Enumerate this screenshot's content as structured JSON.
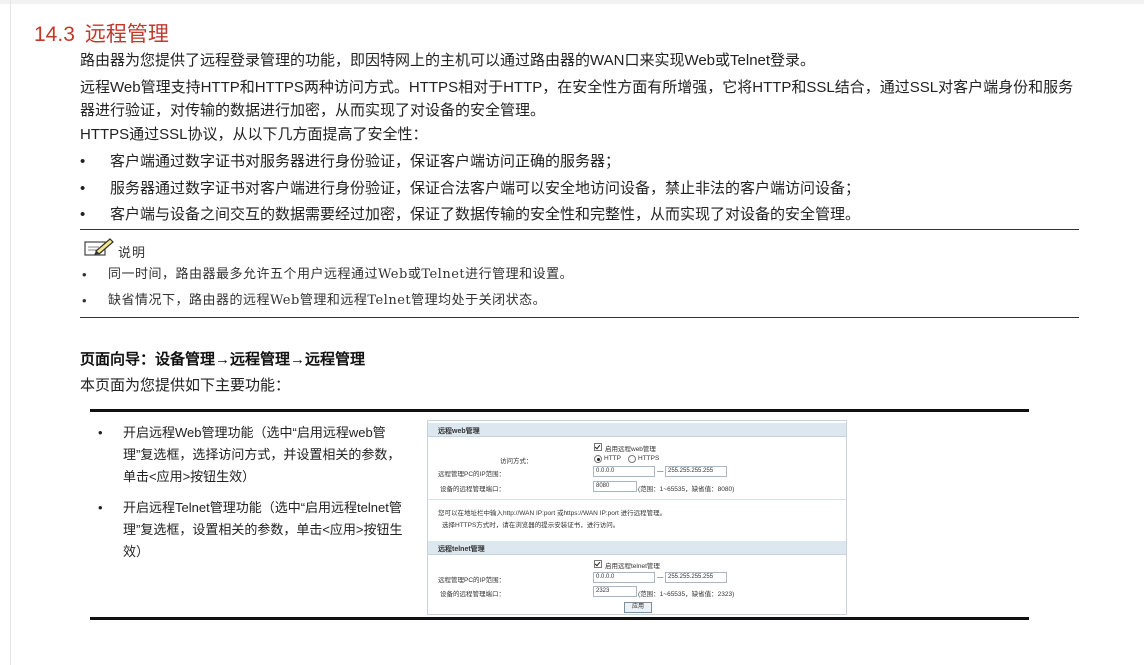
{
  "section": {
    "number": "14.3",
    "title": "远程管理"
  },
  "paragraphs": {
    "p1": "路由器为您提供了远程登录管理的功能，即因特网上的主机可以通过路由器的WAN口来实现Web或Telnet登录。",
    "p2": "远程Web管理支持HTTP和HTTPS两种访问方式。HTTPS相对于HTTP，在安全性方面有所增强，它将HTTP和SSL结合，通过SSL对客户端身份和服务器进行验证，对传输的数据进行加密，从而实现了对设备的安全管理。",
    "p3": "HTTPS通过SSL协议，从以下几方面提高了安全性："
  },
  "bullets": [
    "客户端通过数字证书对服务器进行身份验证，保证客户端访问正确的服务器；",
    "服务器通过数字证书对客户端进行身份验证，保证合法客户端可以安全地访问设备，禁止非法的客户端访问设备；",
    "客户端与设备之间交互的数据需要经过加密，保证了数据传输的安全性和完整性，从而实现了对设备的安全管理。"
  ],
  "note": {
    "label": "说明",
    "items": [
      "同一时间，路由器最多允许五个用户远程通过Web或Telnet进行管理和设置。",
      "缺省情况下，路由器的远程Web管理和远程Telnet管理均处于关闭状态。"
    ]
  },
  "nav_guide": "页面向导：设备管理→远程管理→远程管理",
  "intro": "本页面为您提供如下主要功能：",
  "features": [
    "开启远程Web管理功能（选中“启用远程web管理”复选框，选择访问方式，并设置相关的参数，单击<应用>按钮生效）",
    "开启远程Telnet管理功能（选中“启用远程telnet管理”复选框，设置相关的参数，单击<应用>按钮生效）"
  ],
  "screenshot": {
    "web_title": "远程web管理",
    "web_enable": "启用远程web管理",
    "access_label": "访问方式：",
    "http": "HTTP",
    "https": "HTTPS",
    "ip_range_label": "远程管理PC的IP范围：",
    "ip_from": "0.0.0.0",
    "ip_sep": "—",
    "ip_to": "255.255.255.255",
    "web_port_label": "设备的远程管理端口：",
    "web_port": "8080",
    "web_port_hint": "(范围：1~65535，缺省值：8080)",
    "tip1": "您可以在地址栏中输入http://WAN IP:port 或https://WAN IP:port 进行远程管理。",
    "tip2": "选择HTTPS方式时，请在浏览器的提示安装证书，进行访问。",
    "telnet_title": "远程telnet管理",
    "telnet_enable": "启用远程telnet管理",
    "telnet_ip_label": "远程管理PC的IP范围：",
    "telnet_ip_from": "0.0.0.0",
    "telnet_ip_sep": "—",
    "telnet_ip_to": "255.255.255.255",
    "telnet_port_label": "设备的远程管理端口：",
    "telnet_port": "2323",
    "telnet_port_hint": "(范围：1~65535，缺省值：2323)",
    "apply": "应用"
  },
  "icons": {
    "note": "pencil-note-icon"
  }
}
